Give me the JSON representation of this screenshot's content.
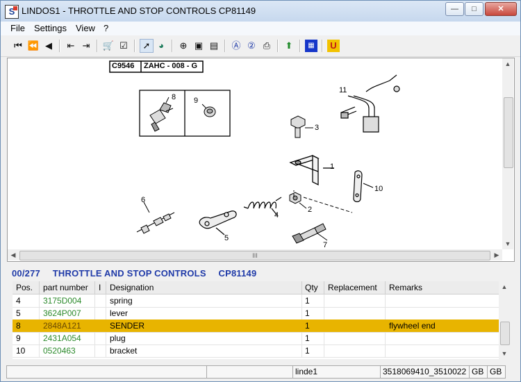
{
  "window": {
    "title": "LINDOS1 - THROTTLE AND STOP CONTROLS    CP81149",
    "app_icon_letter": "S",
    "controls": {
      "minimize": "—",
      "maximize": "□",
      "close": "✕"
    }
  },
  "menu": {
    "items": [
      "File",
      "Settings",
      "View",
      "?"
    ]
  },
  "toolbar": {
    "icons": [
      "first-icon",
      "rewind-icon",
      "previous-icon",
      "back-to-list-icon",
      "forward-list-icon",
      "basket-icon",
      "checklist-icon",
      "pointer-tool-icon",
      "chart-icon",
      "zoom-in-icon",
      "page-icon",
      "page-fit-icon",
      "info-a-icon",
      "help-icon",
      "print-icon",
      "green-arrow-icon",
      "blue-grid-icon",
      "u-icon"
    ]
  },
  "drawing": {
    "drawing_number": "C9546",
    "drawing_code": "ZAHC - 008 - G",
    "callouts": [
      "1",
      "2",
      "3",
      "4",
      "5",
      "6",
      "7",
      "8",
      "9",
      "10",
      "11"
    ]
  },
  "scroll": {
    "grip": "III"
  },
  "info": {
    "counter": "00/277",
    "title": "THROTTLE AND STOP CONTROLS",
    "code": "CP81149"
  },
  "table": {
    "headers": [
      "Pos.",
      "part number",
      "I",
      "Designation",
      "Qty",
      "Replacement",
      "Remarks"
    ],
    "rows": [
      {
        "pos": "4",
        "part": "3175D004",
        "designation": "spring",
        "qty": "1",
        "replacement": "",
        "remarks": "",
        "selected": false
      },
      {
        "pos": "5",
        "part": "3624P007",
        "designation": "lever",
        "qty": "1",
        "replacement": "",
        "remarks": "",
        "selected": false
      },
      {
        "pos": "8",
        "part": "2848A121",
        "designation": "SENDER",
        "qty": "1",
        "replacement": "",
        "remarks": "flywheel end",
        "selected": true
      },
      {
        "pos": "9",
        "part": "2431A054",
        "designation": "plug",
        "qty": "1",
        "replacement": "",
        "remarks": "",
        "selected": false
      },
      {
        "pos": "10",
        "part": "0520463",
        "designation": "bracket",
        "qty": "1",
        "replacement": "",
        "remarks": "",
        "selected": false
      }
    ]
  },
  "status": {
    "panel_user": "linde1",
    "panel_serial": "3518069410_3510022",
    "panel_lang1": "GB",
    "panel_lang2": "GB"
  }
}
